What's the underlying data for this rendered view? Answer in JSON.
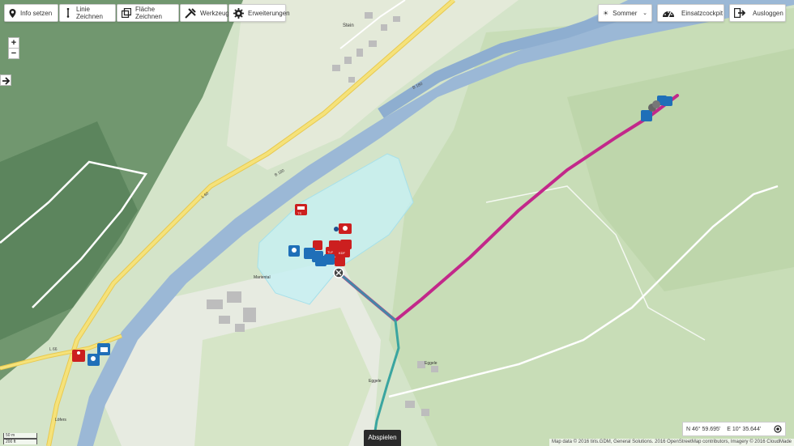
{
  "toolbar": {
    "info_label": "Info setzen",
    "line_label": "Linie Zeichnen",
    "area_label": "Fläche Zeichnen",
    "tools_label": "Werkzeuge",
    "settings_label": "Erweiterungen"
  },
  "right_toolbar": {
    "season_label": "Sommer",
    "cockpit_label": "Einsatzcockpit",
    "logout_label": "Ausloggen"
  },
  "zoom": {
    "in": "+",
    "out": "−"
  },
  "map_labels": {
    "town_stein": "Stein",
    "town_mariental": "Mariental",
    "town_eggele": "Eggele",
    "town_lofers": "Löfers",
    "road_b180_a": "B 180",
    "road_b180_b": "B 180",
    "road_l60": "L 60",
    "road_l66": "L 66",
    "hut": "Eggele",
    "vehicle_ts": "TS",
    "marker_tlf": "TLF",
    "marker_kdf": "KDF"
  },
  "coordinates": {
    "lat": "N 46° 59.695'",
    "lon": "E 10° 35.644'"
  },
  "play_label": "Abspielen",
  "attribution": "Map data © 2016 tiris.GDM, General Solutions. 2016 OpenStreetMap contributors, Imagery © 2016 CloudMade",
  "scale": {
    "metric": "50 m",
    "imperial": "200 ft"
  },
  "colors": {
    "river": "#9bb8d6",
    "area_fill": "#c5f0f4",
    "route_magenta": "#c2288a",
    "route_teal": "#3aa5a0",
    "road_yellow": "#f1dd63",
    "marker_red": "#cc1f1f",
    "marker_blue": "#1f6fb8"
  }
}
